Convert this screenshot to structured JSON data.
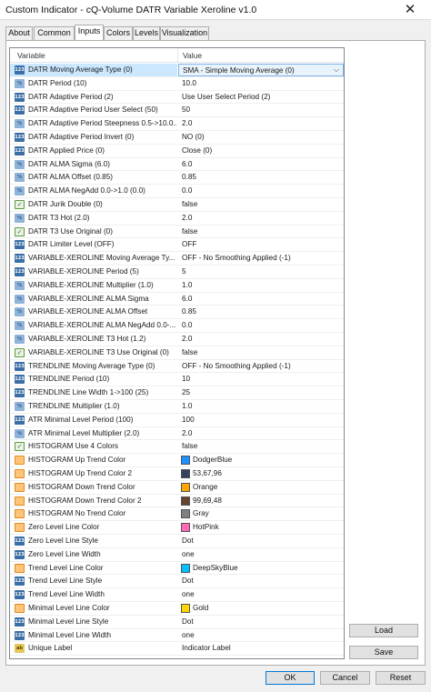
{
  "window": {
    "title": "Custom Indicator - cQ-Volume DATR Variable Xeroline v1.0",
    "close_glyph": "✕"
  },
  "tabs": [
    {
      "label": "About"
    },
    {
      "label": "Common"
    },
    {
      "label": "Inputs"
    },
    {
      "label": "Colors"
    },
    {
      "label": "Levels"
    },
    {
      "label": "Visualization"
    }
  ],
  "active_tab": "Inputs",
  "grid": {
    "header_variable": "Variable",
    "header_value": "Value",
    "selected_row_index": 0,
    "dropdown_glyph": "⌵",
    "rows": [
      {
        "icon": "ic-num",
        "label": "DATR Moving Average Type (0)",
        "value": "SMA - Simple Moving Average (0)"
      },
      {
        "icon": "ic-dbl",
        "label": "DATR Period (10)",
        "value": "10.0"
      },
      {
        "icon": "ic-num",
        "label": "DATR Adaptive Period (2)",
        "value": "Use User Select Period (2)"
      },
      {
        "icon": "ic-num",
        "label": "DATR Adaptive Period User Select (50)",
        "value": "50"
      },
      {
        "icon": "ic-dbl",
        "label": "DATR Adaptive Period Steepness 0.5->10.0...",
        "value": "2.0"
      },
      {
        "icon": "ic-num",
        "label": "DATR Adaptive Period Invert (0)",
        "value": "NO (0)"
      },
      {
        "icon": "ic-num",
        "label": "DATR Applied Price (0)",
        "value": "Close (0)"
      },
      {
        "icon": "ic-dbl",
        "label": "DATR ALMA Sigma (6.0)",
        "value": "6.0"
      },
      {
        "icon": "ic-dbl",
        "label": "DATR ALMA Offset (0.85)",
        "value": "0.85"
      },
      {
        "icon": "ic-dbl",
        "label": "DATR ALMA NegAdd 0.0->1.0 (0.0)",
        "value": "0.0"
      },
      {
        "icon": "ic-bool",
        "label": "DATR Jurik Double (0)",
        "value": "false"
      },
      {
        "icon": "ic-dbl",
        "label": "DATR T3 Hot (2.0)",
        "value": "2.0"
      },
      {
        "icon": "ic-bool",
        "label": "DATR T3 Use Original (0)",
        "value": "false"
      },
      {
        "icon": "ic-num",
        "label": "DATR Limiter Level (OFF)",
        "value": "OFF"
      },
      {
        "icon": "ic-num",
        "label": "VARIABLE-XEROLINE Moving Average Ty...",
        "value": "OFF - No Smoothing Applied (-1)"
      },
      {
        "icon": "ic-num",
        "label": "VARIABLE-XEROLINE Period (5)",
        "value": "5"
      },
      {
        "icon": "ic-dbl",
        "label": "VARIABLE-XEROLINE Multiplier (1.0)",
        "value": "1.0"
      },
      {
        "icon": "ic-dbl",
        "label": "VARIABLE-XEROLINE ALMA Sigma",
        "value": "6.0"
      },
      {
        "icon": "ic-dbl",
        "label": "VARIABLE-XEROLINE ALMA Offset",
        "value": "0.85"
      },
      {
        "icon": "ic-dbl",
        "label": "VARIABLE-XEROLINE ALMA NegAdd 0.0-...",
        "value": "0.0"
      },
      {
        "icon": "ic-dbl",
        "label": "VARIABLE-XEROLINE T3 Hot (1.2)",
        "value": "2.0"
      },
      {
        "icon": "ic-bool",
        "label": "VARIABLE-XEROLINE T3 Use Original (0)",
        "value": "false"
      },
      {
        "icon": "ic-num",
        "label": "TRENDLINE Moving Average Type (0)",
        "value": "OFF - No Smoothing Applied (-1)"
      },
      {
        "icon": "ic-num",
        "label": "TRENDLINE Period (10)",
        "value": "10"
      },
      {
        "icon": "ic-num",
        "label": "TRENDLINE Line Width 1->100 (25)",
        "value": "25"
      },
      {
        "icon": "ic-dbl",
        "label": "TRENDLINE Multiplier (1.0)",
        "value": "1.0"
      },
      {
        "icon": "ic-num",
        "label": "ATR Minimal Level Period (100)",
        "value": "100"
      },
      {
        "icon": "ic-dbl",
        "label": "ATR Minimal Level Multiplier (2.0)",
        "value": "2.0"
      },
      {
        "icon": "ic-bool",
        "label": "HISTOGRAM Use 4 Colors",
        "value": "false"
      },
      {
        "icon": "ic-color",
        "label": "HISTOGRAM Up Trend Color",
        "value": "DodgerBlue",
        "swatch": "#1e90ff"
      },
      {
        "icon": "ic-color",
        "label": "HISTOGRAM Up Trend Color 2",
        "value": "53,67,96",
        "swatch": "#354360"
      },
      {
        "icon": "ic-color",
        "label": "HISTOGRAM Down Trend Color",
        "value": "Orange",
        "swatch": "#ffa500"
      },
      {
        "icon": "ic-color",
        "label": "HISTOGRAM Down Trend Color 2",
        "value": "99,69,48",
        "swatch": "#634530"
      },
      {
        "icon": "ic-color",
        "label": "HISTOGRAM No Trend Color",
        "value": "Gray",
        "swatch": "#808080"
      },
      {
        "icon": "ic-color",
        "label": "Zero Level Line Color",
        "value": "HotPink",
        "swatch": "#ff69b4"
      },
      {
        "icon": "ic-num",
        "label": "Zero Level Line Style",
        "value": "Dot"
      },
      {
        "icon": "ic-num",
        "label": "Zero Level Line Width",
        "value": "one"
      },
      {
        "icon": "ic-color",
        "label": "Trend Level Line Color",
        "value": "DeepSkyBlue",
        "swatch": "#00bfff"
      },
      {
        "icon": "ic-num",
        "label": "Trend Level Line Style",
        "value": "Dot"
      },
      {
        "icon": "ic-num",
        "label": "Trend Level Line Width",
        "value": "one"
      },
      {
        "icon": "ic-color",
        "label": "Minimal Level Line Color",
        "value": "Gold",
        "swatch": "#ffd700"
      },
      {
        "icon": "ic-num",
        "label": "Minimal Level Line Style",
        "value": "Dot"
      },
      {
        "icon": "ic-num",
        "label": "Minimal Level Line Width",
        "value": "one"
      },
      {
        "icon": "ic-str",
        "label": "Unique Label",
        "value": "Indicator Label"
      }
    ]
  },
  "icon_glyphs": {
    "ic-num": "123",
    "ic-dbl": "½",
    "ic-bool": "✓",
    "ic-color": "",
    "ic-str": "ab"
  },
  "side_buttons": {
    "load": "Load",
    "save": "Save"
  },
  "footer_buttons": {
    "ok": "OK",
    "cancel": "Cancel",
    "reset": "Reset"
  }
}
